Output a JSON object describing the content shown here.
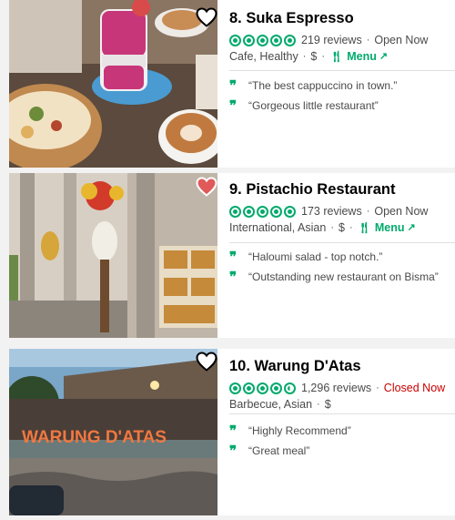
{
  "listings": [
    {
      "title": "8. Suka Espresso",
      "rating_bubbles": 5,
      "reviews": "219 reviews",
      "status": "Open Now",
      "categories": "Cafe, Healthy",
      "price": "$",
      "menu_label": "Menu",
      "quotes": [
        "“The best cappuccino in town.”",
        "“Gorgeous little restaurant”"
      ],
      "favorited": false,
      "icon": "heart-icon"
    },
    {
      "title": "9. Pistachio Restaurant",
      "rating_bubbles": 5,
      "reviews": "173 reviews",
      "status": "Open Now",
      "categories": "International, Asian",
      "price": "$",
      "menu_label": "Menu",
      "quotes": [
        "“Haloumi salad - top notch.”",
        "“Outstanding new restaurant on Bisma”"
      ],
      "favorited": true,
      "icon": "heart-icon"
    },
    {
      "title": "10. Warung D'Atas",
      "rating_bubbles": 4.5,
      "reviews": "1,296 reviews",
      "status": "Closed Now",
      "categories": "Barbecue, Asian",
      "price": "$",
      "quotes": [
        "“Highly Recommend”",
        "“Great meal”"
      ],
      "sign_text": "WARUNG D'ATAS",
      "favorited": false,
      "icon": "heart-icon"
    }
  ],
  "separator": "·",
  "colors": {
    "brand_green": "#00aa6c",
    "closed_red": "#cc0000",
    "heart_active": "#e05a5a"
  }
}
